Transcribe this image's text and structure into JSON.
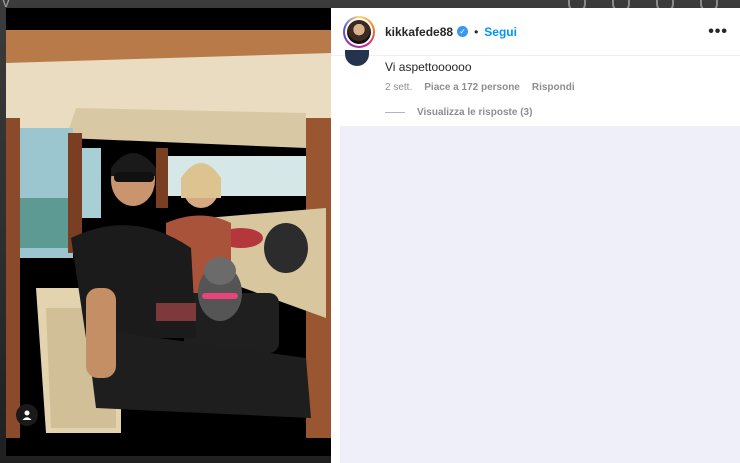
{
  "post": {
    "username": "kikkafede88",
    "verified_badge": "✓",
    "separator": "•",
    "follow_label": "Segui",
    "more_label": "•••"
  },
  "comment": {
    "text": "Vi aspettoooooo",
    "time": "2 sett.",
    "likes": "Piace a 172 persone",
    "reply_label": "Rispondi",
    "view_replies": "Visualizza le risposte (3)"
  },
  "colors": {
    "link_blue": "#0095f6",
    "muted": "#8e8e8e",
    "verified": "#3897f0"
  },
  "icons": {
    "tag": "user-tag-icon",
    "more": "more-options-icon"
  }
}
